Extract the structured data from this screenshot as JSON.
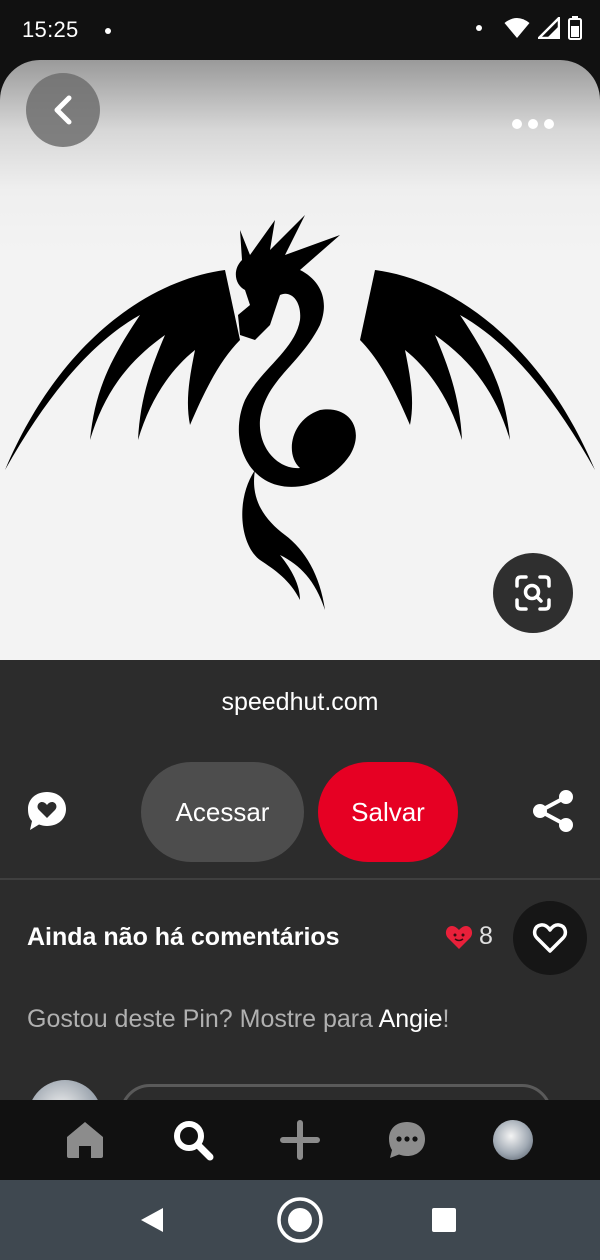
{
  "status_bar": {
    "time": "15:25",
    "icons": [
      "notification-dot-icon",
      "wifi-icon",
      "signal-icon",
      "battery-icon"
    ]
  },
  "pin": {
    "image_alt": "Dragon tribal tattoo design",
    "source": "speedhut.com",
    "actions": {
      "visit_label": "Acessar",
      "save_label": "Salvar"
    }
  },
  "comments": {
    "title": "Ainda não há comentários",
    "reaction_count": "8",
    "prompt_prefix": "Gostou deste Pin? Mostre para ",
    "prompt_name": "Angie",
    "prompt_suffix": "!"
  },
  "bottom_nav": {
    "items": [
      "home-icon",
      "search-icon",
      "create-icon",
      "messages-icon",
      "profile-avatar"
    ]
  },
  "colors": {
    "save_red": "#e60023",
    "panel_bg": "#2c2c2c",
    "heart_red": "#e9203a"
  }
}
